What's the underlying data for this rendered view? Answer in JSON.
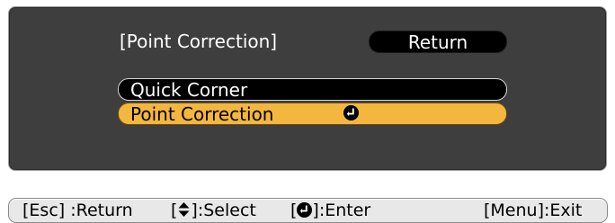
{
  "menu": {
    "title": "[Point Correction]",
    "return_label": "Return",
    "items": [
      {
        "label": "Quick Corner",
        "selected": false
      },
      {
        "label": "Point Correction",
        "selected": true,
        "icon": "enter-icon"
      }
    ]
  },
  "help_bar": {
    "esc_return": "[Esc] :Return",
    "select_prefix": "[",
    "select_suffix": "]:Select",
    "select_icon": "up-down-arrow-icon",
    "enter_prefix": "[",
    "enter_suffix": "]:Enter",
    "enter_icon": "enter-icon",
    "menu_exit": "[Menu]:Exit"
  },
  "colors": {
    "panel_background": "#3e3e3e",
    "item_background": "#000000",
    "selected_background": "#f3b73f",
    "help_bar_background": "#e8e8e8"
  }
}
